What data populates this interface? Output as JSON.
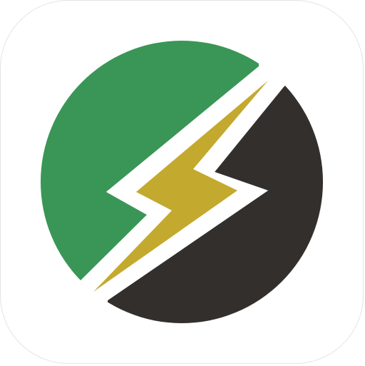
{
  "app_icon": {
    "name": "lightning-circle-logo",
    "colors": {
      "background": "#ffffff",
      "tile_border": "#e4e4e4",
      "green": "#3a9656",
      "dark": "#322f2c",
      "gold": "#c4a92f",
      "gap": "#ffffff"
    },
    "icons": [
      "app-tile-icon",
      "lightning-bolt-icon"
    ]
  }
}
